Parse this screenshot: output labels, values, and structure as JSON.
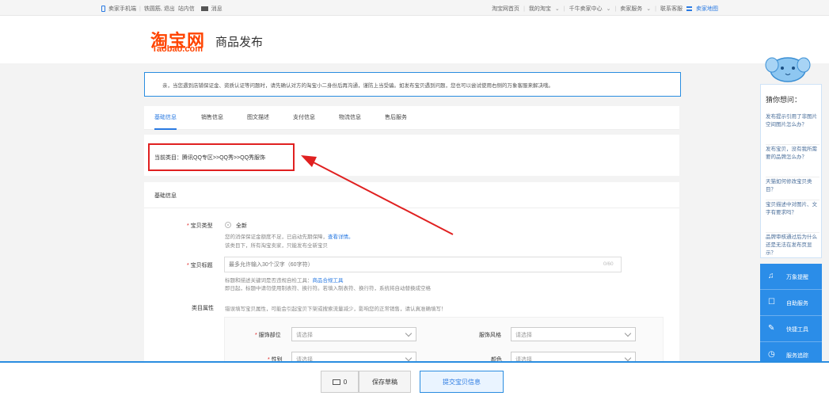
{
  "topbar": {
    "left": {
      "mobile": "卖家手机端",
      "user": "铁圆筋, 退出",
      "inbox": "站内信",
      "message": "消息"
    },
    "right": {
      "home": "淘宝网首页",
      "my_taobao": "我的淘宝",
      "qianniu": "千牛卖家中心",
      "seller_service": "卖家服务",
      "contact": "联系客服",
      "sitemap": "卖家地图"
    }
  },
  "header": {
    "logo_cn": "淘宝网",
    "logo_en": "Taobao.com",
    "title": "商品发布"
  },
  "notice": "亲，当您遇到店铺保证金、资质认证等问题时，请先确认对方的淘宝小二身份后再沟通，谨防上当受骗。如发布宝贝遇到问题，您也可以尝试使用右侧的万象客服来解决哦。",
  "tabs": [
    {
      "label": "基础信息",
      "active": true
    },
    {
      "label": "销售信息"
    },
    {
      "label": "图文描述"
    },
    {
      "label": "支付信息"
    },
    {
      "label": "物流信息"
    },
    {
      "label": "售后服务"
    }
  ],
  "category": "当前类目：腾讯QQ专区>>QQ秀>>QQ秀服饰",
  "form": {
    "section_title": "基础信息",
    "item_type": {
      "label": "宝贝类型",
      "option": "全新",
      "help1": "您的消保保证金额度不足，已启动先期保障，",
      "help1_link": "查看详情。",
      "help2": "该类目下，所有淘宝卖家，只能发布全新宝贝"
    },
    "item_title": {
      "label": "宝贝标题",
      "placeholder": "最多允许输入30个汉字（60字符）",
      "counter": "0/60",
      "help1": "标题和描述关键词是否违规自检工具：",
      "help1_link": "商品合规工具",
      "help2": "即日起，标题中请勿使用制表符、换行符。若填入制表符、换行符，系统将自动替换成空格"
    },
    "attributes": {
      "label": "类目属性",
      "help": "错误填写宝贝属性，可能会引起宝贝下架或搜索流量减少，影响您的正常销售，请认真准确填写！",
      "fields": [
        {
          "label": "服饰部位",
          "required": true,
          "value": "请选择"
        },
        {
          "label": "服饰风格",
          "required": false,
          "value": "请选择"
        },
        {
          "label": "性别",
          "required": true,
          "value": "请选择"
        },
        {
          "label": "颜色",
          "required": false,
          "value": "请选择"
        }
      ]
    }
  },
  "assistant": {
    "title": "猜你想问：",
    "faqs": [
      "发布提示引用了非图片空间图片怎么办？",
      "发布宝贝，没有我所需要的品牌怎么办？",
      "天猫如何修改宝贝类目？",
      "宝贝描述中对图片、文字有要求吗？",
      "品牌审核通过后为什么还是无法在发布页显示？"
    ],
    "buttons": [
      {
        "label": "万象提醒",
        "icon": "bell-icon"
      },
      {
        "label": "自助服务",
        "icon": "chat-icon"
      },
      {
        "label": "快捷工具",
        "icon": "wrench-icon"
      },
      {
        "label": "服务追踪",
        "icon": "clock-icon"
      }
    ]
  },
  "footer": {
    "message_count": "0",
    "save_draft": "保存草稿",
    "submit": "提交宝贝信息"
  },
  "colors": {
    "brand": "#ff4400",
    "accent": "#2a8de0",
    "annotation": "#e02020"
  }
}
